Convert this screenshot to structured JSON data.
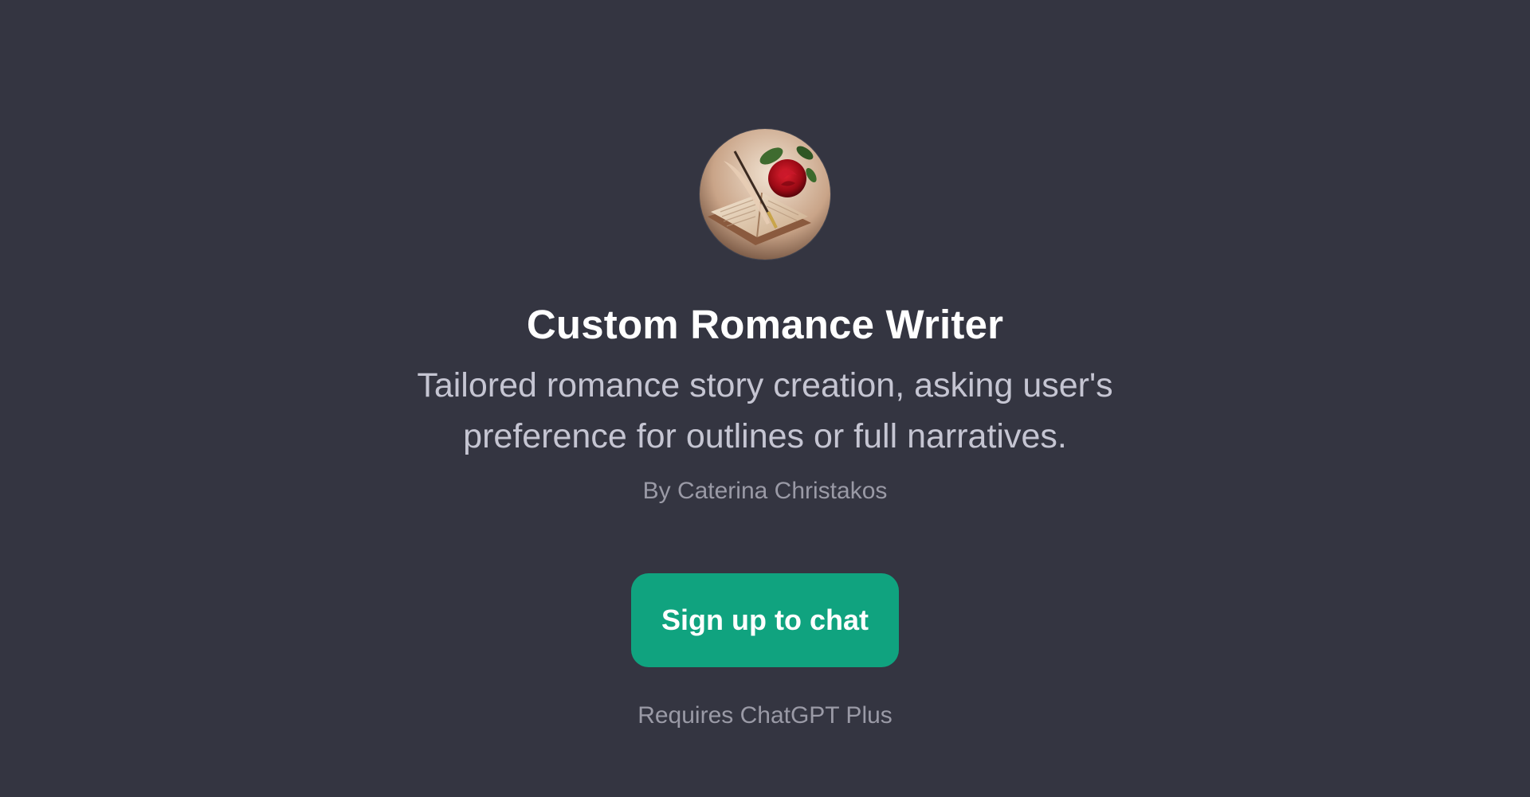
{
  "gpt": {
    "name": "Custom Romance Writer",
    "description": "Tailored romance story creation, asking user's preference for outlines or full narratives.",
    "author": "By Caterina Christakos",
    "avatar_icon": "rose-and-quill-on-book-icon"
  },
  "actions": {
    "signup_label": "Sign up to chat",
    "requirement": "Requires ChatGPT Plus"
  },
  "colors": {
    "background": "#343541",
    "accent": "#10a37f",
    "title": "#ffffff",
    "description": "#c5c5d2",
    "muted": "#9a9aa6"
  }
}
